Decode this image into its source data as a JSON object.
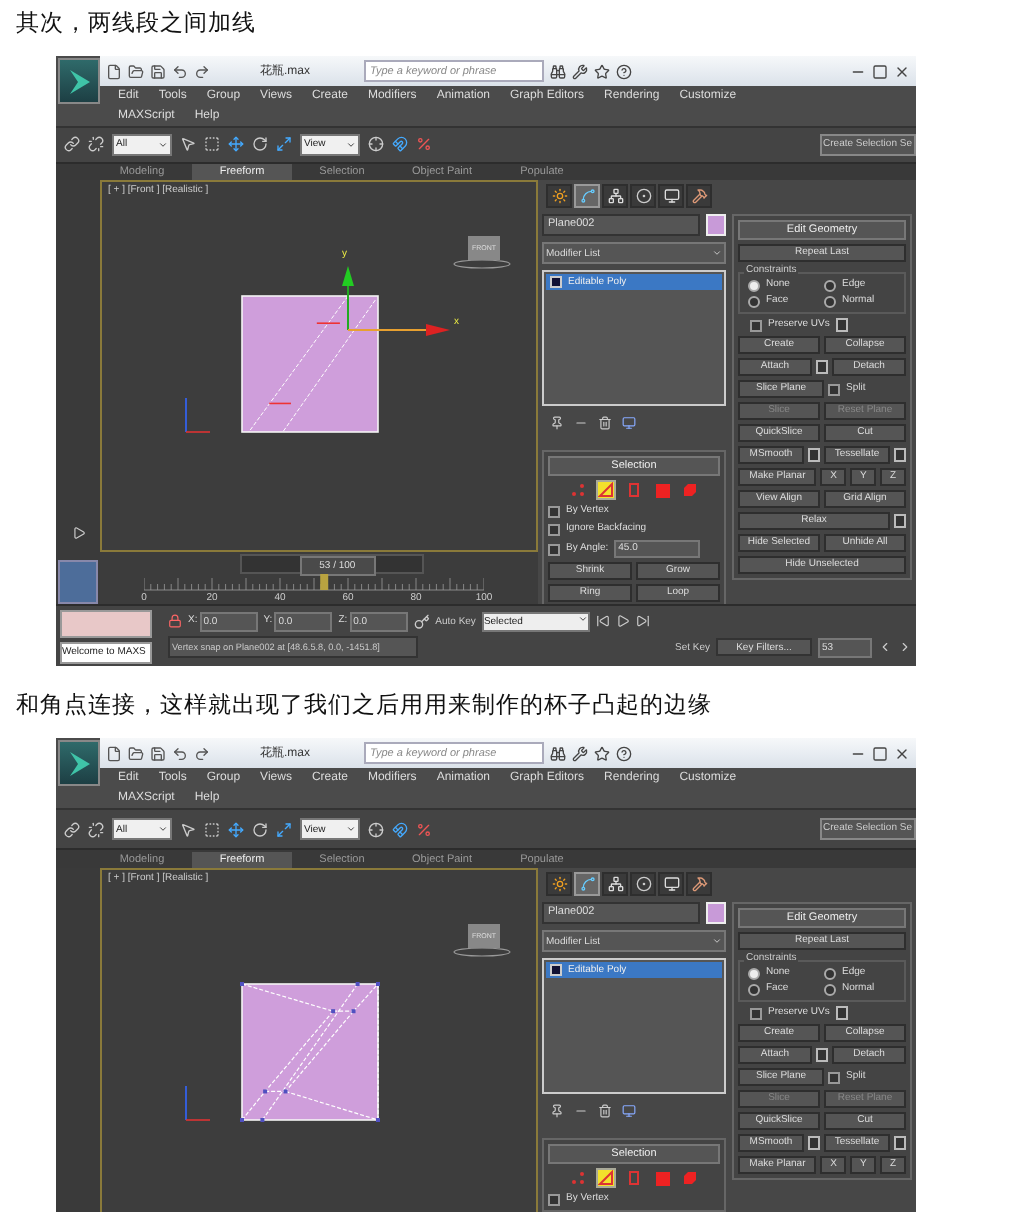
{
  "sections": [
    {
      "caption": "其次，两线段之间加线",
      "screenshot": {
        "title_bar": {
          "file_name": "花瓶.max",
          "search": {
            "placeholder": "Type a keyword or phrase"
          }
        },
        "menu_rows": [
          [
            "Edit",
            "Tools",
            "Group",
            "Views",
            "Create",
            "Modifiers",
            "Animation",
            "Graph Editors",
            "Rendering",
            "Customize"
          ],
          [
            "MAXScript",
            "Help"
          ]
        ],
        "toolbar": {
          "selection_filter": "All",
          "reference_coordinate": "View",
          "named_selection": "Create Selection Se"
        },
        "ribbon_tabs": [
          {
            "label": "Modeling",
            "selected": false
          },
          {
            "label": "Freeform",
            "selected": true
          },
          {
            "label": "Selection",
            "selected": false
          },
          {
            "label": "Object Paint",
            "selected": false
          },
          {
            "label": "Populate",
            "selected": false
          }
        ],
        "viewport": {
          "label": "[ + ] [Front ] [Realistic ]",
          "viewcube": "FRONT",
          "axis_x": "x",
          "axis_y": "y",
          "mesh": {
            "kind": "parallel-cuts"
          }
        },
        "command_panel": {
          "tabs": [
            {
              "kind": "create",
              "selected": false
            },
            {
              "kind": "modify",
              "selected": true
            },
            {
              "kind": "hierarchy",
              "selected": false
            },
            {
              "kind": "motion",
              "selected": false
            },
            {
              "kind": "display",
              "selected": false
            },
            {
              "kind": "utilities",
              "selected": false
            }
          ],
          "object_name": "Plane002",
          "modifier_list": "Modifier List",
          "stack": [
            {
              "label": "Editable Poly",
              "selected": true
            }
          ],
          "selection": {
            "title": "Selection",
            "levels": [
              {
                "kind": "vertex",
                "selected": false
              },
              {
                "kind": "edge",
                "selected": true
              },
              {
                "kind": "border",
                "selected": false
              },
              {
                "kind": "polygon",
                "selected": false
              },
              {
                "kind": "element",
                "selected": false
              }
            ],
            "options": [
              {
                "label": "By Vertex",
                "checked": false
              },
              {
                "label": "Ignore Backfacing",
                "checked": false
              }
            ],
            "by_angle": {
              "label": "By Angle:",
              "checked": false,
              "value": "45.0"
            },
            "buttons": [
              [
                "Shrink",
                "Grow"
              ],
              [
                "Ring",
                "Loop"
              ]
            ]
          },
          "edit_geometry": {
            "title": "Edit Geometry",
            "repeat_last": "Repeat Last",
            "constraints_label": "Constraints",
            "constraints": [
              {
                "label": "None",
                "selected": true
              },
              {
                "label": "Edge",
                "selected": false
              },
              {
                "label": "Face",
                "selected": false
              },
              {
                "label": "Normal",
                "selected": false
              }
            ],
            "preserve_uvs": {
              "label": "Preserve UVs",
              "checked": false
            },
            "rows": [
              [
                {
                  "kind": "button",
                  "label": "Create",
                  "disabled": false
                },
                {
                  "kind": "button",
                  "label": "Collapse",
                  "disabled": false
                }
              ],
              [
                {
                  "kind": "settings",
                  "label": "Attach",
                  "disabled": false
                },
                {
                  "kind": "button",
                  "label": "Detach",
                  "disabled": false
                }
              ],
              [
                {
                  "kind": "button",
                  "label": "Slice Plane",
                  "disabled": false
                },
                {
                  "kind": "checkbox",
                  "label": "Split",
                  "checked": false
                }
              ],
              [
                {
                  "kind": "button",
                  "label": "Slice",
                  "disabled": true
                },
                {
                  "kind": "button",
                  "label": "Reset Plane",
                  "disabled": true
                }
              ],
              [
                {
                  "kind": "button",
                  "label": "QuickSlice",
                  "disabled": false
                },
                {
                  "kind": "button",
                  "label": "Cut",
                  "disabled": false
                }
              ],
              [
                {
                  "kind": "settings",
                  "label": "MSmooth",
                  "disabled": false
                },
                {
                  "kind": "settings",
                  "label": "Tessellate",
                  "disabled": false
                }
              ],
              [
                {
                  "kind": "button",
                  "label": "Make Planar",
                  "disabled": false
                },
                {
                  "kind": "axis",
                  "label": "X",
                  "disabled": false
                },
                {
                  "kind": "axis",
                  "label": "Y",
                  "disabled": false
                },
                {
                  "kind": "axis",
                  "label": "Z",
                  "disabled": false
                }
              ],
              [
                {
                  "kind": "button",
                  "label": "View Align",
                  "disabled": false
                },
                {
                  "kind": "button",
                  "label": "Grid Align",
                  "disabled": false
                }
              ],
              [
                {
                  "kind": "settings",
                  "label": "Relax",
                  "disabled": false
                }
              ],
              [
                {
                  "kind": "button",
                  "label": "Hide Selected",
                  "disabled": false
                },
                {
                  "kind": "button",
                  "label": "Unhide All",
                  "disabled": false
                }
              ],
              [
                {
                  "kind": "button",
                  "label": "Hide Unselected",
                  "disabled": false
                }
              ]
            ]
          }
        },
        "timeline": {
          "frame_label": "53 / 100",
          "level": 0.53,
          "tick_labels": [
            "0",
            "20",
            "40",
            "60",
            "80",
            "100"
          ]
        },
        "status_bar": {
          "welcome": "Welcome to MAXS",
          "prompt": "Vertex snap on Plane002 at [48.6.5.8, 0.0, -1451.8]",
          "coordinates": [
            {
              "axis": "X:",
              "value": "0.0"
            },
            {
              "axis": "Y:",
              "value": "0.0"
            },
            {
              "axis": "Z:",
              "value": "0.0"
            }
          ],
          "auto_key": "Auto Key",
          "key_mode": "Selected",
          "set_key": "Set Key",
          "key_filters": "Key Filters...",
          "frame": "53"
        }
      }
    },
    {
      "caption": "和角点连接，这样就出现了我们之后用用来制作的杯子凸起的边缘",
      "screenshot": {
        "title_bar": {
          "file_name": "花瓶.max",
          "search": {
            "placeholder": "Type a keyword or phrase"
          }
        },
        "menu_rows": [
          [
            "Edit",
            "Tools",
            "Group",
            "Views",
            "Create",
            "Modifiers",
            "Animation",
            "Graph Editors",
            "Rendering",
            "Customize"
          ],
          [
            "MAXScript",
            "Help"
          ]
        ],
        "toolbar": {
          "selection_filter": "All",
          "reference_coordinate": "View",
          "named_selection": "Create Selection Se"
        },
        "ribbon_tabs": [
          {
            "label": "Modeling",
            "selected": false
          },
          {
            "label": "Freeform",
            "selected": true
          },
          {
            "label": "Selection",
            "selected": false
          },
          {
            "label": "Object Paint",
            "selected": false
          },
          {
            "label": "Populate",
            "selected": false
          }
        ],
        "viewport": {
          "label": "[ + ] [Front ] [Realistic ]",
          "viewcube": "FRONT",
          "mesh": {
            "kind": "corner-connected"
          }
        },
        "command_panel": {
          "tabs": [
            {
              "kind": "create",
              "selected": false
            },
            {
              "kind": "modify",
              "selected": true
            },
            {
              "kind": "hierarchy",
              "selected": false
            },
            {
              "kind": "motion",
              "selected": false
            },
            {
              "kind": "display",
              "selected": false
            },
            {
              "kind": "utilities",
              "selected": false
            }
          ],
          "object_name": "Plane002",
          "modifier_list": "Modifier List",
          "stack": [
            {
              "label": "Editable Poly",
              "selected": true
            }
          ],
          "selection": {
            "title": "Selection",
            "levels": [
              {
                "kind": "vertex",
                "selected": false
              },
              {
                "kind": "edge",
                "selected": true
              },
              {
                "kind": "border",
                "selected": false
              },
              {
                "kind": "polygon",
                "selected": false
              },
              {
                "kind": "element",
                "selected": false
              }
            ],
            "options": [
              {
                "label": "By Vertex",
                "checked": false
              }
            ]
          },
          "edit_geometry": {
            "title": "Edit Geometry",
            "repeat_last": "Repeat Last",
            "constraints_label": "Constraints",
            "constraints": [
              {
                "label": "None",
                "selected": true
              },
              {
                "label": "Edge",
                "selected": false
              },
              {
                "label": "Face",
                "selected": false
              },
              {
                "label": "Normal",
                "selected": false
              }
            ],
            "preserve_uvs": {
              "label": "Preserve UVs",
              "checked": false
            },
            "rows": [
              [
                {
                  "kind": "button",
                  "label": "Create",
                  "disabled": false
                },
                {
                  "kind": "button",
                  "label": "Collapse",
                  "disabled": false
                }
              ],
              [
                {
                  "kind": "settings",
                  "label": "Attach",
                  "disabled": false
                },
                {
                  "kind": "button",
                  "label": "Detach",
                  "disabled": false
                }
              ],
              [
                {
                  "kind": "button",
                  "label": "Slice Plane",
                  "disabled": false
                },
                {
                  "kind": "checkbox",
                  "label": "Split",
                  "checked": false
                }
              ],
              [
                {
                  "kind": "button",
                  "label": "Slice",
                  "disabled": true
                },
                {
                  "kind": "button",
                  "label": "Reset Plane",
                  "disabled": true
                }
              ],
              [
                {
                  "kind": "button",
                  "label": "QuickSlice",
                  "disabled": false
                },
                {
                  "kind": "button",
                  "label": "Cut",
                  "disabled": false
                }
              ],
              [
                {
                  "kind": "settings",
                  "label": "MSmooth",
                  "disabled": false
                },
                {
                  "kind": "settings",
                  "label": "Tessellate",
                  "disabled": false
                }
              ],
              [
                {
                  "kind": "button",
                  "label": "Make Planar",
                  "disabled": false
                },
                {
                  "kind": "axis",
                  "label": "X",
                  "disabled": false
                },
                {
                  "kind": "axis",
                  "label": "Y",
                  "disabled": false
                },
                {
                  "kind": "axis",
                  "label": "Z",
                  "disabled": false
                }
              ]
            ]
          }
        }
      }
    }
  ]
}
